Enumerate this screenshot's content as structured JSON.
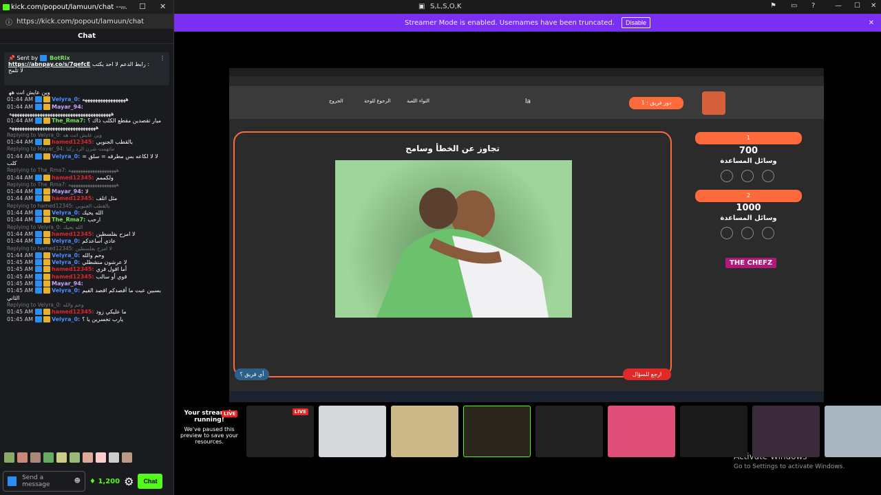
{
  "popout_title": "kick.com/popout/lamuun/chat - ...",
  "popout_url": "https://kick.com/popout/lamuun/chat",
  "chat_heading": "Chat",
  "pinned": {
    "sent_by": "Sent by",
    "user": "BotRix",
    "link": "https://abnpay.co/s/7qefcE",
    "text_ar": "رابط الدعم لا احد يكتب :",
    "text_ar2": "لا تلمح"
  },
  "messages": [
    {
      "time": "",
      "user": "",
      "text": "وين عايش انت هه‍‍‍‍‍‍‍‍‍‍‍‍‍‍‍‍‍‍‍‍‍‍‍‍",
      "color": "#fff"
    },
    {
      "time": "01:44 AM",
      "user": "Velyra_0:",
      "text": "هههههههههههههههههه",
      "color": "#4e8cff"
    },
    {
      "time": "01:44 AM",
      "user": "Mayar_94:",
      "text": "",
      "color": "#c9a5ff"
    },
    {
      "time": "",
      "user": "",
      "text": "ههههههههههههههههههههههههههههههههههههههههه",
      "color": "#fff"
    },
    {
      "time": "01:44 AM",
      "user": "The_Rma7:",
      "text": "ميار تقصدين مقطع الكلب ذاك ؟",
      "color": "#7be359"
    },
    {
      "time": "",
      "user": "",
      "text": "ههههههههههههههههههههههههههههههههههه",
      "color": "#fff"
    },
    {
      "reply": "Replying to Velyra_0: وين عايش انت هه"
    },
    {
      "time": "01:44 AM",
      "user": "hamed12345:",
      "text": "بالقطب الجنوبي",
      "color": "#e0242c"
    },
    {
      "reply": "Replying to Mayar_94: ماتهمت شرن الرد ركنا"
    },
    {
      "time": "01:44 AM",
      "user": "Velyra_0:",
      "text": "لا لا لكاعه بس مطرقه = سلق = كلب",
      "color": "#4e8cff"
    },
    {
      "reply": "Replying to The_Rma7: ههههههههههههههههههههه"
    },
    {
      "time": "01:44 AM",
      "user": "hamed12345:",
      "text": "ولكممم",
      "color": "#e0242c"
    },
    {
      "reply": "Replying to The_Rma7: ههههههههههههههههههههه"
    },
    {
      "time": "01:44 AM",
      "user": "Mayar_94:",
      "text": "لا",
      "color": "#c9a5ff"
    },
    {
      "time": "01:44 AM",
      "user": "hamed12345:",
      "text": "مثل اتلف",
      "color": "#e0242c"
    },
    {
      "reply": "Replying to hamed12345: بالقطب الجنوبي"
    },
    {
      "time": "01:44 AM",
      "user": "Velyra_0:",
      "text": "الله يحيك",
      "color": "#4e8cff"
    },
    {
      "time": "01:44 AM",
      "user": "The_Rma7:",
      "text": "ارحب",
      "color": "#7be359"
    },
    {
      "reply": "Replying to Velyra_0: الله يحيك"
    },
    {
      "time": "01:44 AM",
      "user": "hamed12345:",
      "text": "لا امزح بفلسطين",
      "color": "#e0242c"
    },
    {
      "time": "01:44 AM",
      "user": "Velyra_0:",
      "text": "عادي أساعدكم",
      "color": "#4e8cff"
    },
    {
      "reply": "Replying to hamed12345: لا امزح بفلسطين"
    },
    {
      "time": "01:44 AM",
      "user": "Velyra_0:",
      "text": "وحم والله",
      "color": "#4e8cff"
    },
    {
      "time": "01:45 AM",
      "user": "Velyra_0:",
      "text": "لا عرشون منشطلي",
      "color": "#4e8cff"
    },
    {
      "time": "01:45 AM",
      "user": "hamed12345:",
      "text": "أما اقول قري",
      "color": "#e0242c"
    },
    {
      "time": "01:45 AM",
      "user": "hamed12345:",
      "text": "قوي أو سالب",
      "color": "#e0242c"
    },
    {
      "time": "01:45 AM",
      "user": "Mayar_94:",
      "text": "",
      "color": "#c9a5ff"
    },
    {
      "time": "01:45 AM",
      "user": "Velyra_0:",
      "text": "بسبين عبت ما أقصدكم اقصد الفيم الثاني",
      "color": "#4e8cff"
    },
    {
      "reply": "Replying to Velyra_0: وحم والله"
    },
    {
      "time": "01:45 AM",
      "user": "hamed12345:",
      "text": "ما عليكي زود",
      "color": "#e0242c"
    },
    {
      "time": "01:45 AM",
      "user": "Velyra_0:",
      "text": "يارب تخسرين يا ؟",
      "color": "#4e8cff"
    }
  ],
  "input": {
    "placeholder": "Send a message",
    "points": "1,200",
    "chat_button": "Chat"
  },
  "window_title": "S,L,S,O,K",
  "banner": {
    "text": "Streamer Mode is enabled. Usernames have been truncated.",
    "button": "Disable"
  },
  "game": {
    "team_turn": "دور فريق : 1",
    "center_text": "la",
    "menu": [
      "الجروج",
      "الرجوع للوحة",
      "التواء اللعبة"
    ],
    "question": "تجاوز عن الخطأ وسامح",
    "team1_score": "700",
    "team1_label": "وسائل المساعدة",
    "team1_num": "1",
    "team2_score": "1000",
    "team2_label": "وسائل المساعدة",
    "team2_num": "2",
    "brand": "THE CHEFZ",
    "back": "ارجع للسؤال",
    "which_team": "أي فريق ؟"
  },
  "preview": {
    "title": "Your stream is running!",
    "body": "We've paused this preview to save your resources.",
    "live": "LIVE"
  },
  "activate": {
    "title": "Activate Windows",
    "sub": "Go to Settings to activate Windows."
  }
}
